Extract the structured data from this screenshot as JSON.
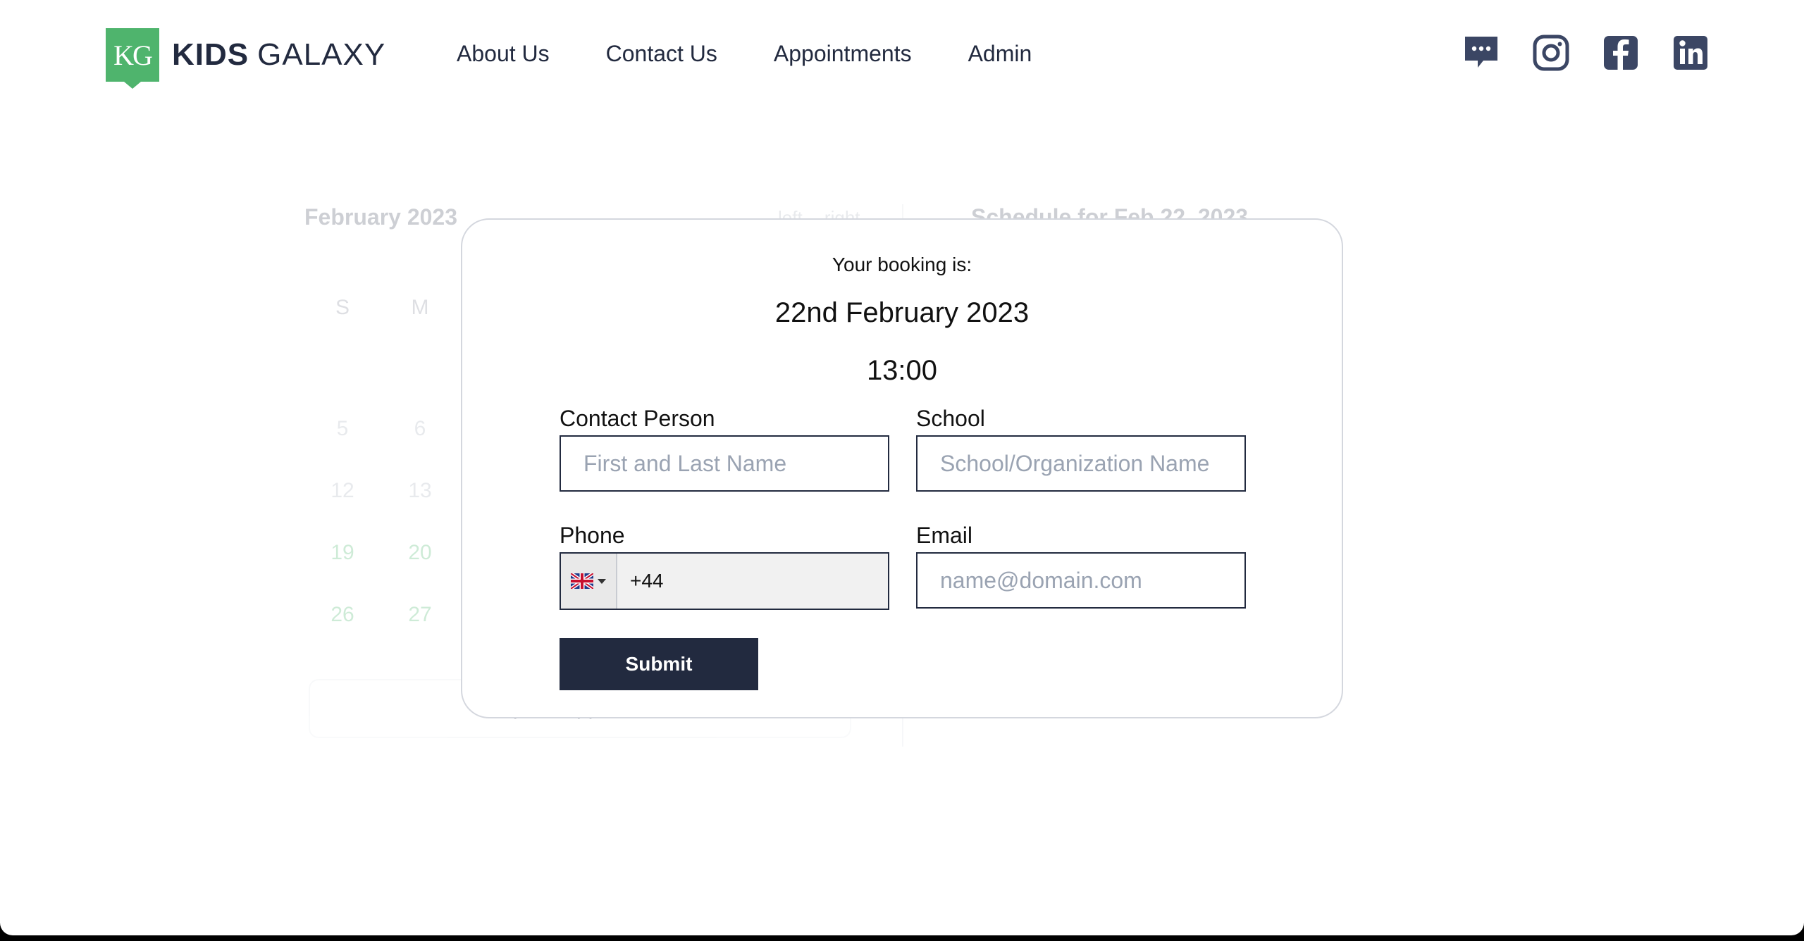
{
  "header": {
    "logo_badge": "KG",
    "logo_bold": "KIDS",
    "logo_light": "GALAXY",
    "nav": [
      "About Us",
      "Contact Us",
      "Appointments",
      "Admin"
    ],
    "social_icons": [
      "chat-icon",
      "instagram-icon",
      "facebook-icon",
      "linkedin-icon"
    ]
  },
  "background": {
    "calendar_title": "February 2023",
    "nav_left": "left",
    "nav_right": "right",
    "schedule_title": "Schedule for Feb 22, 2023",
    "days_of_week": [
      "S",
      "M"
    ],
    "weeks": [
      [
        "5",
        "6"
      ],
      [
        "12",
        "13"
      ],
      [
        "19",
        "20"
      ],
      [
        "26",
        "27"
      ]
    ],
    "request_button": "Request Appointment"
  },
  "modal": {
    "intro": "Your booking is:",
    "date": "22nd February 2023",
    "time": "13:00",
    "contact_label": "Contact Person",
    "contact_placeholder": "First and Last Name",
    "school_label": "School",
    "school_placeholder": "School/Organization Name",
    "phone_label": "Phone",
    "phone_value": "+44",
    "phone_flag": "uk-flag-icon",
    "email_label": "Email",
    "email_placeholder": "name@domain.com",
    "submit_label": "Submit"
  },
  "colors": {
    "brand_green": "#4fb46d",
    "navy": "#222a3f",
    "available_green": "#27a74f"
  }
}
